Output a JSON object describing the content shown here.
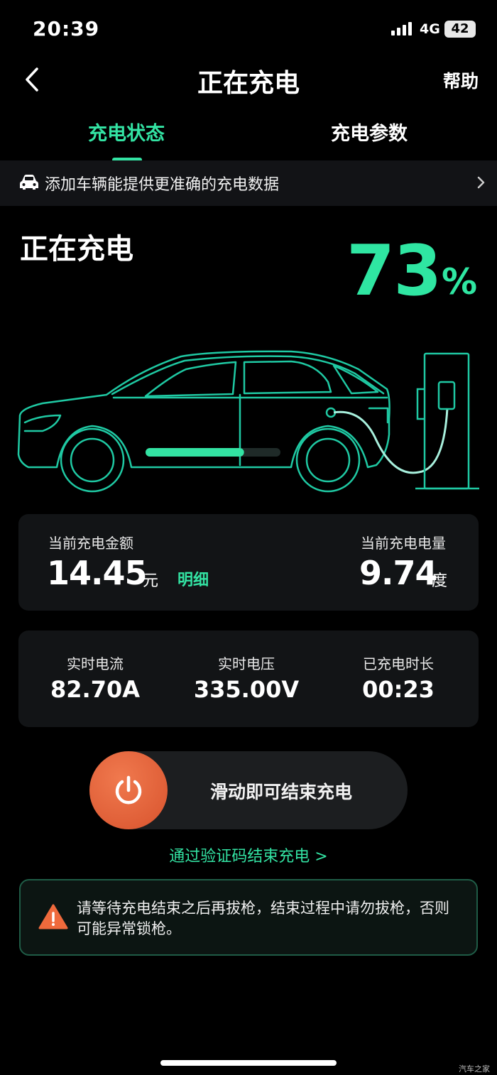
{
  "status_bar": {
    "time": "20:39",
    "network": "4G",
    "battery": "42"
  },
  "nav": {
    "title": "正在充电",
    "help": "帮助"
  },
  "tabs": [
    {
      "label": "充电状态",
      "active": true
    },
    {
      "label": "充电参数",
      "active": false
    }
  ],
  "banner": {
    "text": "添加车辆能提供更准确的充电数据",
    "icon": "car-icon"
  },
  "charging": {
    "status": "正在充电",
    "percent": "73",
    "percent_sign": "%",
    "progress": 0.73
  },
  "cost": {
    "label": "当前充电金额",
    "value": "14.45",
    "unit": "元",
    "detail": "明细"
  },
  "energy": {
    "label": "当前充电电量",
    "value": "9.74",
    "unit": "度"
  },
  "metrics": [
    {
      "label": "实时电流",
      "value": "82.70A"
    },
    {
      "label": "实时电压",
      "value": "335.00V"
    },
    {
      "label": "已充电时长",
      "value": "00:23"
    }
  ],
  "slider": {
    "text": "滑动即可结束充电",
    "icon": "power-icon"
  },
  "verify_link": "通过验证码结束充电 >",
  "warning": {
    "text": "请等待充电结束之后再拔枪，结束过程中请勿拔枪，否则可能异常锁枪。",
    "icon": "warning-icon"
  },
  "watermark": "汽车之家",
  "colors": {
    "accent": "#2fe6a2",
    "slider_knob": "#e0603a",
    "background": "#000000"
  }
}
